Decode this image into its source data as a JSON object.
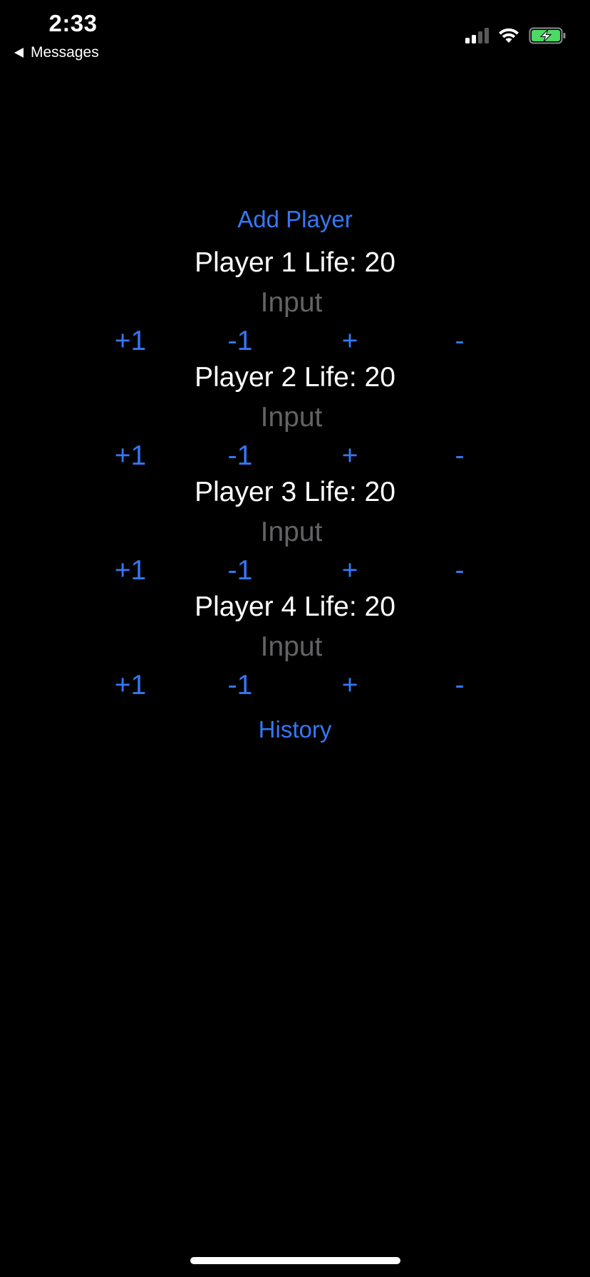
{
  "status_bar": {
    "time": "2:33",
    "back_label": "Messages",
    "icons": [
      "signal-icon",
      "wifi-icon",
      "battery-charging-icon"
    ],
    "battery_color": "#4cd964"
  },
  "main": {
    "add_player_label": "Add Player",
    "history_label": "History",
    "accent_color": "#3478f6",
    "players": [
      {
        "label": "Player 1 Life: 20",
        "input_placeholder": "Input",
        "input_value": "",
        "buttons": {
          "plus_one": "+1",
          "minus_one": "-1",
          "plus": "+",
          "minus": "-"
        }
      },
      {
        "label": "Player 2 Life: 20",
        "input_placeholder": "Input",
        "input_value": "",
        "buttons": {
          "plus_one": "+1",
          "minus_one": "-1",
          "plus": "+",
          "minus": "-"
        }
      },
      {
        "label": "Player 3 Life: 20",
        "input_placeholder": "Input",
        "input_value": "",
        "buttons": {
          "plus_one": "+1",
          "minus_one": "-1",
          "plus": "+",
          "minus": "-"
        }
      },
      {
        "label": "Player 4 Life: 20",
        "input_placeholder": "Input",
        "input_value": "",
        "buttons": {
          "plus_one": "+1",
          "minus_one": "-1",
          "plus": "+",
          "minus": "-"
        }
      }
    ]
  }
}
